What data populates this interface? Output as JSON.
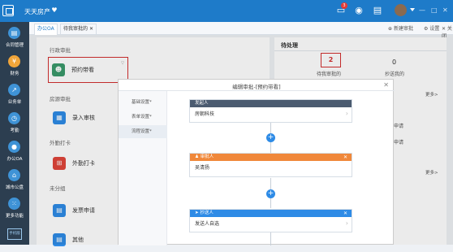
{
  "app": {
    "title": "天天房产"
  },
  "topbar": {
    "badge_count": "3",
    "window_controls": [
      "—",
      "□",
      "✕"
    ]
  },
  "sidebar": {
    "items": [
      {
        "label": "合同管理",
        "icon": "contract-icon"
      },
      {
        "label": "财务",
        "icon": "finance-icon"
      },
      {
        "label": "业务单",
        "icon": "chart-icon"
      },
      {
        "label": "考勤",
        "icon": "clock-icon"
      },
      {
        "label": "办公OA",
        "icon": "user-icon"
      },
      {
        "label": "城市公盘",
        "icon": "home-icon"
      },
      {
        "label": "更多功能",
        "icon": "grid-icon"
      }
    ],
    "bottom_label": "手机版"
  },
  "tabs": [
    {
      "label": "办公OA"
    },
    {
      "label": "待我审批的"
    }
  ],
  "tab_actions": {
    "new_label": "新建审批",
    "settings_label": "设置"
  },
  "left": {
    "section_admin": "行政审批",
    "card_booking": "预约带看",
    "section_housing": "房源审批",
    "card_entry": "录入审核",
    "section_field": "外勤打卡",
    "card_field": "外勤打卡",
    "section_ungrouped": "未分组",
    "card_invoice": "发票申请",
    "card_other": "其他"
  },
  "right": {
    "pending_header": "待处理",
    "pending_mine_count": "2",
    "pending_mine_label": "待我审批的",
    "cc_count": "0",
    "cc_label": "抄送我的",
    "more_label": "更多>",
    "apply_label": "申请"
  },
  "modal": {
    "title": "编辑审批-[预约带看]",
    "nav": [
      "基础设置*",
      "表单设置*",
      "流程设置*"
    ],
    "initiator_head": "发起人",
    "initiator_value": "房朝科技",
    "approver_head": "审批人",
    "approver_value": "吴清扬",
    "cc_head": "抄送人",
    "cc_value": "发送人自选"
  },
  "colors": {
    "topbar": "#1e7bc9",
    "sidebar": "#2c3e50",
    "highlight": "#d32f2f",
    "approver": "#f0883a",
    "plus": "#2e8be6"
  }
}
